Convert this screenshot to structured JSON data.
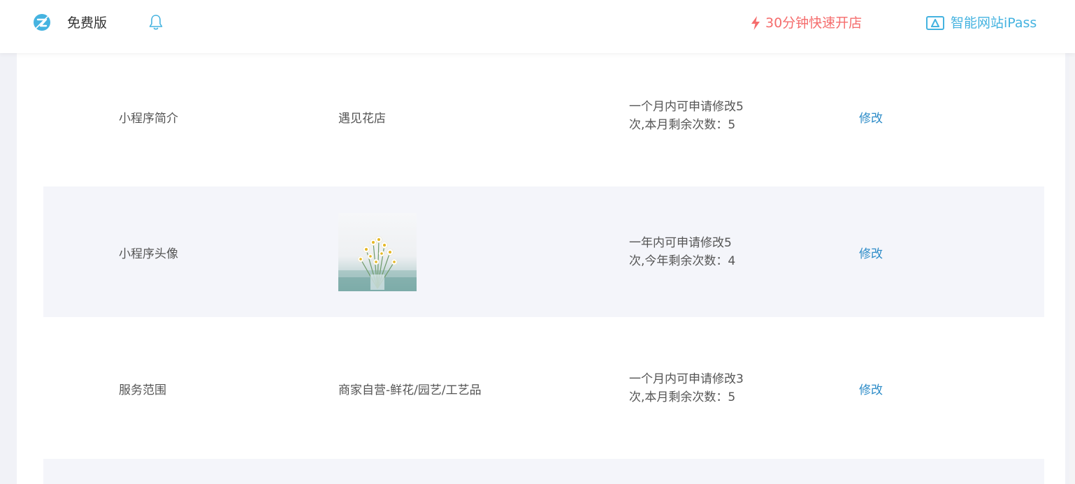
{
  "header": {
    "plan_label": "免费版",
    "quick_open_label": "30分钟快速开店",
    "ipass_label": "智能网站iPass",
    "colors": {
      "quick_open": "#f56c6c",
      "ipass": "#45b3e0",
      "logo": "#45b3e0"
    }
  },
  "rows": [
    {
      "label": "小程序简介",
      "value": "遇见花店",
      "rule_line1": "一个月内可申请修改5",
      "rule_line2": "次,本月剩余次数：5",
      "action": "修改"
    },
    {
      "label": "小程序头像",
      "value_image": "flower-bouquet-avatar",
      "rule_line1": "一年内可申请修改5",
      "rule_line2": "次,今年剩余次数：4",
      "action": "修改"
    },
    {
      "label": "服务范围",
      "value": "商家自营-鲜花/园艺/工艺品",
      "rule_line1": "一个月内可申请修改3",
      "rule_line2": "次,本月剩余次数：5",
      "action": "修改"
    }
  ]
}
